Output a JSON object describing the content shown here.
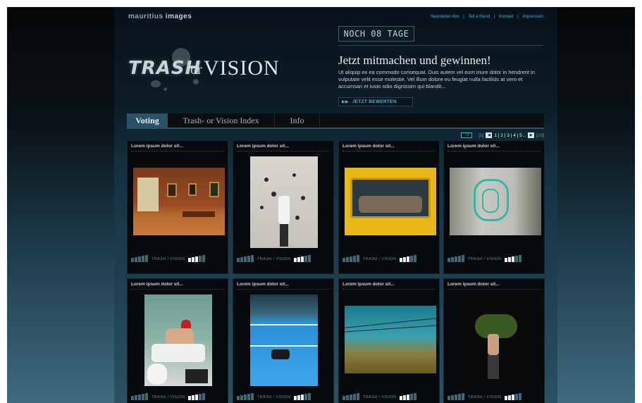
{
  "header": {
    "brand_light": "mauritius",
    "brand_bold": "images",
    "top_links": [
      "Newsletter Abo",
      "|",
      "Tell a friend",
      "|",
      "Kontakt",
      "|",
      "Impressum"
    ],
    "countdown": "NOCH 08 TAGE"
  },
  "logo": {
    "trash": "TRASH",
    "or": "or",
    "vision": "VISION"
  },
  "promo": {
    "headline": "Jetzt mitmachen und gewinnen!",
    "description": "Ut aliquip ex ea commodo consequat. Duis autem vel eum iriure dolor in hendrerit in vulputate velit esse molestie. Vel illum dolore eu feugiat nulla facilisis at vero et accumsan et iusto odio dignissim qui blandit...",
    "cta_arrows": "▶▶",
    "cta_label": "JETZT BEWERTEN"
  },
  "tabs": [
    {
      "label": "Voting",
      "active": true
    },
    {
      "label": "Trash- or Vision Index",
      "active": false
    },
    {
      "label": "Info",
      "active": false
    }
  ],
  "pager": {
    "shuffle": "⤨",
    "first": "[1]",
    "prev": "◀",
    "pages": "1 | 2 | 3 | 4 | 5 ..",
    "next": "▶",
    "last": "[10]"
  },
  "vote_label": "TRASH / VISION",
  "cards": [
    {
      "title": "Lorem ipsum dolor sit...",
      "image": "museum-gallery-photo"
    },
    {
      "title": "Lorem ipsum dolor sit...",
      "image": "person-dots-wall-photo"
    },
    {
      "title": "Lorem ipsum dolor sit...",
      "image": "yellow-tram-photo"
    },
    {
      "title": "Lorem ipsum dolor sit...",
      "image": "graffiti-wall-photo"
    },
    {
      "title": "Lorem ipsum dolor sit...",
      "image": "bathtub-person-photo"
    },
    {
      "title": "Lorem ipsum dolor sit...",
      "image": "empty-pool-photo"
    },
    {
      "title": "Lorem ipsum dolor sit...",
      "image": "field-power-lines-photo"
    },
    {
      "title": "Lorem ipsum dolor sit...",
      "image": "night-person-tree-photo"
    }
  ]
}
